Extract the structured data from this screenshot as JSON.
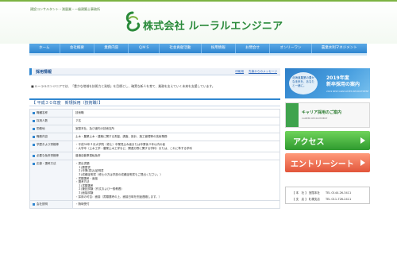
{
  "header": {
    "tagline": "建設コンサルタント・測量業・一級建築士事務所",
    "company": "株式会社 ルーラルエンジニア",
    "brand_color": "#2a8a3a"
  },
  "nav": {
    "items": [
      {
        "label": "ホーム"
      },
      {
        "label": "会社概要"
      },
      {
        "label": "業務内容"
      },
      {
        "label": "ＱＭＳ"
      },
      {
        "label": "社会貢献活動"
      },
      {
        "label": "採用情報"
      },
      {
        "label": "お問合せ"
      },
      {
        "label": "オンリーワン"
      },
      {
        "label": "農業水利マネジメント"
      }
    ],
    "accent": "#2f86d0"
  },
  "main": {
    "section_title": "採用情報",
    "link_print": "印刷用",
    "link_message": "先輩からのメッセージ",
    "intro": "■ ルーラルエンジニアでは、「豊かな地域を技術力と発想」を目標とし、確実な新人を育て、業務を支えていく未来を支援しています。",
    "subheading": "【 平成３０年度　新規採用（技術職）】",
    "rows": [
      {
        "label": "職種名称",
        "lines": [
          "技術職"
        ]
      },
      {
        "label": "採用人数",
        "lines": [
          "２名"
        ]
      },
      {
        "label": "勤務地",
        "lines": [
          "室蘭本社、及び道内の技術支所"
        ]
      },
      {
        "label": "職務内容",
        "lines": [
          "土木・農業土木・建築に関する測量、調査、設計、施工管理等の技術業務"
        ]
      },
      {
        "label": "学歴および資格等",
        "lines": [
          "・平成30年３月大学院（修士）卒業見込み者または卒業後３年以内の者",
          "・大学卒（土木工学・農業土木工学など、関連分野に関する学科）または、これに準ずる学科"
        ]
      },
      {
        "label": "必要な免許資格等",
        "lines": [
          "普通自動車運転免許"
        ]
      },
      {
        "label": "応募・選考方法",
        "lines": [
          "・提出書類",
          "　１)履歴書",
          "　２)卒業(見込)証明書",
          "　３)成績証明書（修士の方は学部の成績証明書もご提出ください。）",
          "・書類選考・面接",
          "・選考方法",
          "　１)書類選考",
          "　２)筆記試験（作文および一般教養）",
          "　３)面接試験",
          "・採用の可否：面接（書類選考の上、面接日時を別途連絡します。）"
        ]
      },
      {
        "label": "会社説明",
        "lines": [
          "・随時受付"
        ]
      }
    ]
  },
  "sidebar": {
    "banner1_left": "北海道農業の豊かな未来を、あなたと一緒に。",
    "banner1_title": "2019年度",
    "banner1_title2": "新卒採用の案内",
    "banner1_small": "2019 NEW GRADUATES RECRUITMENT",
    "banner2_title": "キャリア採用のご案内",
    "banner2_small": "CAREER RECRUITMENT",
    "access_label": "アクセス",
    "entry_label": "エントリーシート",
    "contact_office1": "【 本　社 】",
    "contact_city1": "室蘭本社",
    "contact_tel1": "TEL 0144-26-3411",
    "contact_office2": "【 支　店 】",
    "contact_city2": "札幌支店",
    "contact_tel2": "TEL 011-726-2411"
  }
}
